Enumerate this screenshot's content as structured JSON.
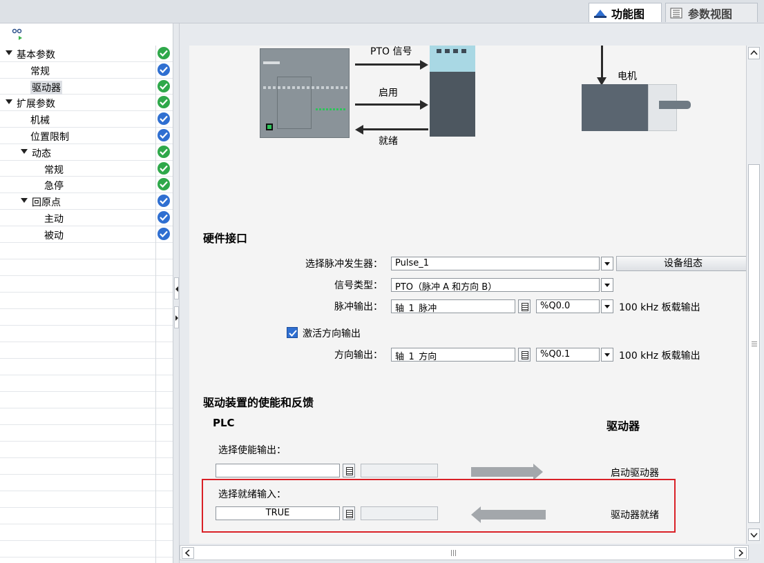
{
  "tabs": [
    {
      "label": "功能图",
      "icon": "function-diagram-icon",
      "active": true
    },
    {
      "label": "参数视图",
      "icon": "parameter-view-icon",
      "active": false
    }
  ],
  "sidebar": {
    "header_icon": "navigation-icon",
    "items": [
      {
        "label": "基本参数",
        "level": 0,
        "expanded": true,
        "status": "green"
      },
      {
        "label": "常规",
        "level": 1,
        "status": "blue"
      },
      {
        "label": "驱动器",
        "level": 1,
        "status": "green",
        "selected": true
      },
      {
        "label": "扩展参数",
        "level": 0,
        "expanded": true,
        "status": "green"
      },
      {
        "label": "机械",
        "level": 1,
        "status": "blue"
      },
      {
        "label": "位置限制",
        "level": 1,
        "status": "blue"
      },
      {
        "label": "动态",
        "level": 1,
        "expanded": true,
        "status": "green"
      },
      {
        "label": "常规",
        "level": 2,
        "status": "green"
      },
      {
        "label": "急停",
        "level": 2,
        "status": "green"
      },
      {
        "label": "回原点",
        "level": 1,
        "expanded": true,
        "status": "blue"
      },
      {
        "label": "主动",
        "level": 2,
        "status": "blue"
      },
      {
        "label": "被动",
        "level": 2,
        "status": "blue"
      }
    ]
  },
  "diagram": {
    "pto_signal": "PTO 信号",
    "enable": "启用",
    "ready": "就绪",
    "motor": "电机"
  },
  "hardware": {
    "title": "硬件接口",
    "pulse_gen_label": "选择脉冲发生器：",
    "pulse_gen_value": "Pulse_1",
    "device_config_button": "设备组态",
    "signal_type_label": "信号类型：",
    "signal_type_value": "PTO（脉冲 A 和方向 B）",
    "pulse_output_label": "脉冲输出：",
    "pulse_output_tag": "轴_1_脉冲",
    "pulse_output_addr": "%Q0.0",
    "pulse_output_note": "100 kHz 板载输出",
    "dir_checkbox_label": "激活方向输出",
    "dir_checkbox_checked": true,
    "dir_output_label": "方向输出：",
    "dir_output_tag": "轴_1_方向",
    "dir_output_addr": "%Q0.1",
    "dir_output_note": "100 kHz 板载输出"
  },
  "drive": {
    "title": "驱动装置的使能和反馈",
    "plc_col": "PLC",
    "drive_col": "驱动器",
    "enable_output_label": "选择使能输出：",
    "enable_output_value": "",
    "enable_drive_label": "启动驱动器",
    "ready_input_label": "选择就绪输入：",
    "ready_input_value": "TRUE",
    "drive_ready_label": "驱动器就绪"
  },
  "colors": {
    "status_green": "#2fa84a",
    "status_blue": "#2f6fd1",
    "highlight_red": "#d92026"
  }
}
